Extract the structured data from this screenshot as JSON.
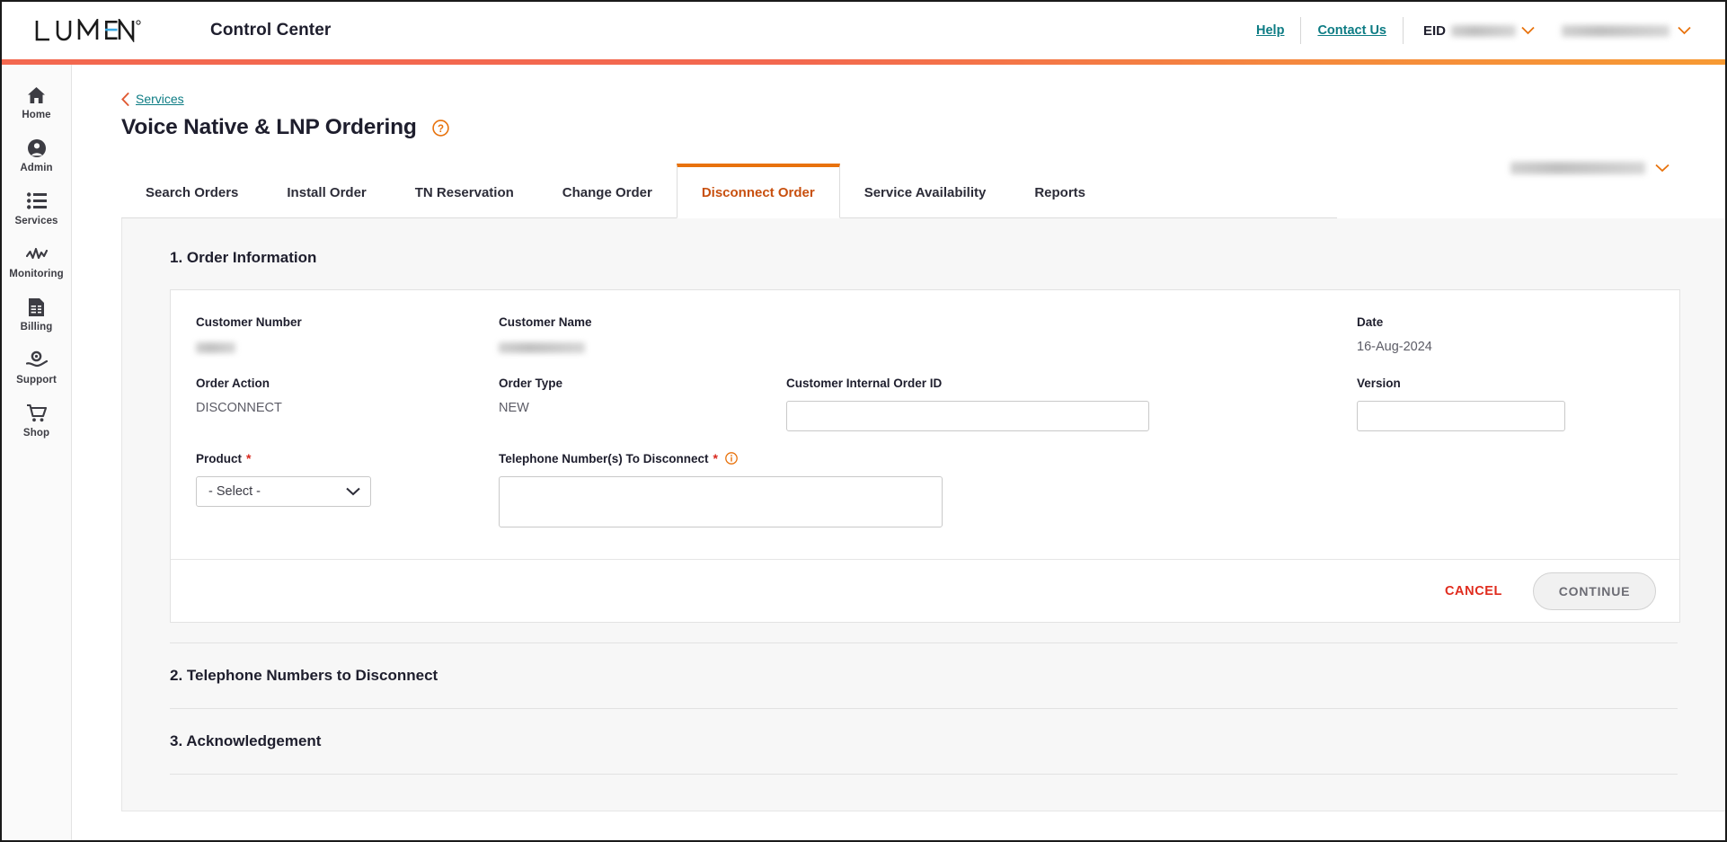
{
  "header": {
    "brand": "LUMEN",
    "app_name": "Control Center",
    "help_label": "Help",
    "contact_label": "Contact Us",
    "eid_label": "EID",
    "eid_value": "",
    "account_value": "",
    "accent_orange": "#f3684f",
    "link_teal": "#0d7c84"
  },
  "sidebar": {
    "items": [
      {
        "label": "Home",
        "icon": "home-icon"
      },
      {
        "label": "Admin",
        "icon": "user-circle-icon"
      },
      {
        "label": "Services",
        "icon": "list-icon"
      },
      {
        "label": "Monitoring",
        "icon": "activity-icon"
      },
      {
        "label": "Billing",
        "icon": "invoice-icon"
      },
      {
        "label": "Support",
        "icon": "support-hand-icon"
      },
      {
        "label": "Shop",
        "icon": "cart-icon"
      }
    ]
  },
  "page": {
    "breadcrumb": "Services",
    "title": "Voice Native & LNP Ordering",
    "help_icon": "question-circle-icon",
    "account_selector_value": ""
  },
  "tabs": [
    {
      "label": "Search Orders",
      "active": false
    },
    {
      "label": "Install Order",
      "active": false
    },
    {
      "label": "TN Reservation",
      "active": false
    },
    {
      "label": "Change Order",
      "active": false
    },
    {
      "label": "Disconnect Order",
      "active": true
    },
    {
      "label": "Service Availability",
      "active": false
    },
    {
      "label": "Reports",
      "active": false
    }
  ],
  "form": {
    "section_title": "1. Order Information",
    "customer_number_label": "Customer Number",
    "customer_number_value": "",
    "customer_name_label": "Customer Name",
    "customer_name_value": "",
    "date_label": "Date",
    "date_value": "16-Aug-2024",
    "order_action_label": "Order Action",
    "order_action_value": "DISCONNECT",
    "order_type_label": "Order Type",
    "order_type_value": "NEW",
    "internal_order_id_label": "Customer Internal Order ID",
    "internal_order_id_value": "",
    "internal_order_id_placeholder": "",
    "version_label": "Version",
    "version_value": "",
    "version_placeholder": "",
    "product_label": "Product",
    "product_required": "*",
    "product_selected": "- Select -",
    "product_options": [
      "- Select -"
    ],
    "tn_label": "Telephone Number(s) To Disconnect",
    "tn_required": "*",
    "tn_info_icon": "info-circle-icon",
    "tn_value": "",
    "tn_placeholder": "",
    "cancel_label": "CANCEL",
    "continue_label": "CONTINUE"
  },
  "sections": {
    "two": "2. Telephone Numbers to Disconnect",
    "three": "3. Acknowledgement"
  }
}
